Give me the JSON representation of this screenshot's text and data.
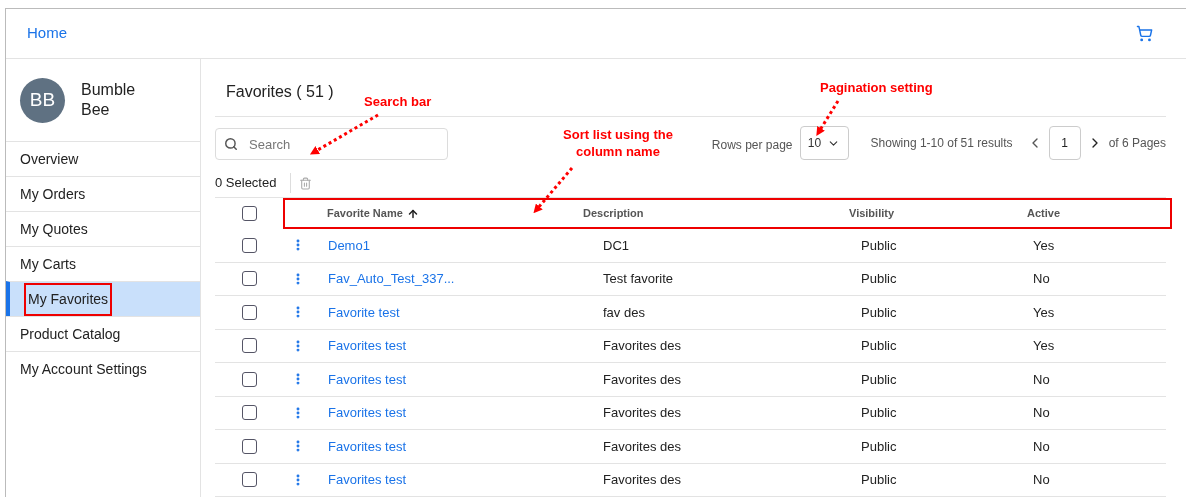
{
  "header": {
    "home_link": "Home"
  },
  "profile": {
    "initials": "BB",
    "name": "Bumble Bee"
  },
  "sidebar": {
    "items": [
      {
        "label": "Overview",
        "selected": false,
        "highlighted": false
      },
      {
        "label": "My Orders",
        "selected": false,
        "highlighted": false
      },
      {
        "label": "My Quotes",
        "selected": false,
        "highlighted": false
      },
      {
        "label": "My Carts",
        "selected": false,
        "highlighted": false
      },
      {
        "label": "My Favorites",
        "selected": true,
        "highlighted": true
      },
      {
        "label": "Product Catalog",
        "selected": false,
        "highlighted": false
      },
      {
        "label": "My Account Settings",
        "selected": false,
        "highlighted": false
      }
    ]
  },
  "page_title": "Favorites ( 51 )",
  "search": {
    "placeholder": "Search"
  },
  "pagination": {
    "rows_per_page_label": "Rows per page",
    "rows_per_page": "10",
    "summary": "Showing 1-10 of 51 results",
    "page": "1",
    "of_pages": "of 6 Pages"
  },
  "selection": {
    "count_label": "0 Selected",
    "select_all_checked": false
  },
  "table": {
    "highlighted": true,
    "columns": [
      {
        "label": "Favorite Name",
        "sorted": true
      },
      {
        "label": "Description",
        "sorted": false
      },
      {
        "label": "Visibility",
        "sorted": false
      },
      {
        "label": "Active",
        "sorted": false
      }
    ],
    "rows": [
      {
        "checked": false,
        "name": "Demo1",
        "description": "DC1",
        "visibility": "Public",
        "active": "Yes"
      },
      {
        "checked": false,
        "name": "Fav_Auto_Test_337...",
        "description": "Test favorite",
        "visibility": "Public",
        "active": "No"
      },
      {
        "checked": false,
        "name": "Favorite test",
        "description": "fav des",
        "visibility": "Public",
        "active": "Yes"
      },
      {
        "checked": false,
        "name": "Favorites test",
        "description": "Favorites des",
        "visibility": "Public",
        "active": "Yes"
      },
      {
        "checked": false,
        "name": "Favorites test",
        "description": "Favorites des",
        "visibility": "Public",
        "active": "No"
      },
      {
        "checked": false,
        "name": "Favorites test",
        "description": "Favorites des",
        "visibility": "Public",
        "active": "No"
      },
      {
        "checked": false,
        "name": "Favorites test",
        "description": "Favorites des",
        "visibility": "Public",
        "active": "No"
      },
      {
        "checked": false,
        "name": "Favorites test",
        "description": "Favorites des",
        "visibility": "Public",
        "active": "No"
      }
    ]
  },
  "annotations": [
    {
      "kind": "search",
      "text": "Search bar"
    },
    {
      "kind": "sort",
      "text": "Sort list using the column name"
    },
    {
      "kind": "pagination",
      "text": "Pagination setting"
    }
  ]
}
